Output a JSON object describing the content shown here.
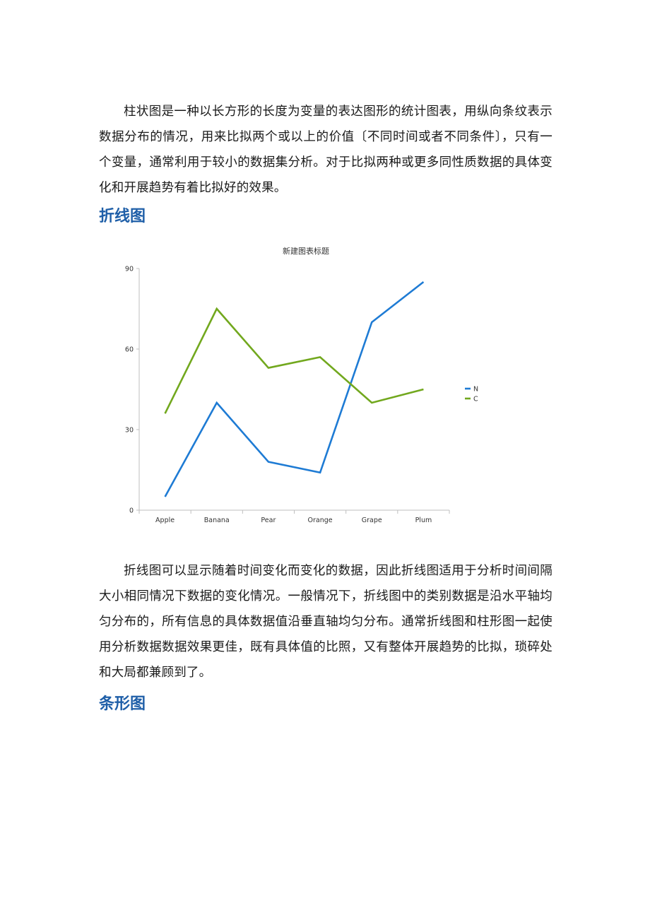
{
  "document": {
    "paragraph_1": "柱状图是一种以长方形的长度为变量的表达图形的统计图表，用纵向条纹表示数据分布的情况，用来比拟两个或以上的价值〔不同时间或者不同条件〕，只有一个变量，通常利用于较小的数据集分析。对于比拟两种或更多同性质数据的具体变化和开展趋势有着比拟好的效果。",
    "heading_1": "折线图",
    "paragraph_2": "折线图可以显示随着时间变化而变化的数据，因此折线图适用于分析时间间隔大小相同情况下数据的变化情况。一般情况下，折线图中的类别数据是沿水平轴均匀分布的，所有信息的具体数据值沿垂直轴均匀分布。通常折线图和柱形图一起使用分析数据数据效果更佳，既有具体值的比照，又有整体开展趋势的比拟，琐碎处和大局都兼顾到了。",
    "heading_2": "条形图",
    "colors": {
      "heading": "#1f5fa8",
      "series_n": "#1e7bd4",
      "series_c": "#72a81e"
    }
  },
  "chart_data": {
    "type": "line",
    "title": "新建图表标题",
    "xlabel": "",
    "ylabel": "",
    "categories": [
      "Apple",
      "Banana",
      "Pear",
      "Orange",
      "Grape",
      "Plum"
    ],
    "series": [
      {
        "name": "N",
        "color": "#1e7bd4",
        "values": [
          5,
          40,
          18,
          14,
          70,
          85
        ]
      },
      {
        "name": "C",
        "color": "#72a81e",
        "values": [
          36,
          75,
          53,
          57,
          40,
          45
        ]
      }
    ],
    "ylim": [
      0,
      90
    ],
    "yticks": [
      0,
      30,
      60,
      90
    ],
    "grid": false,
    "legend": "right"
  }
}
